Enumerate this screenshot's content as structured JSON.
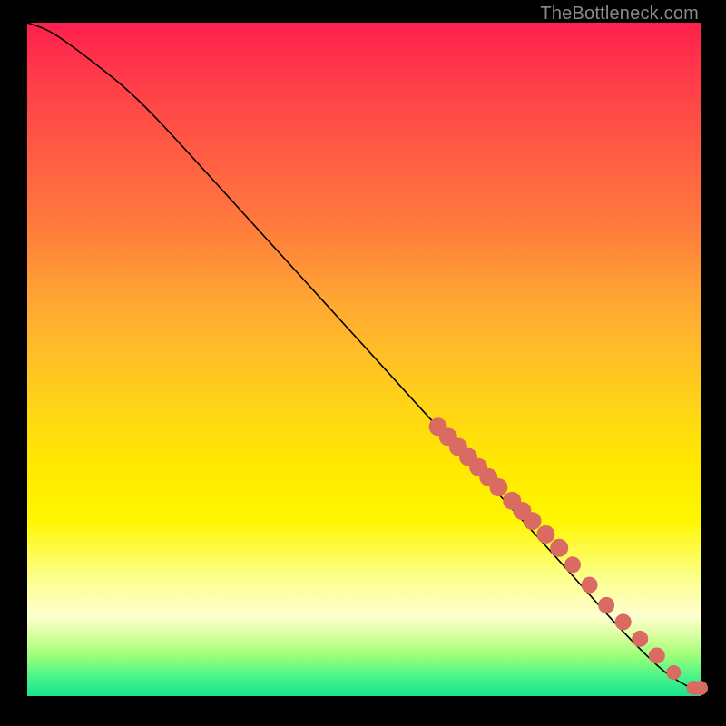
{
  "attribution": "TheBottleneck.com",
  "colors": {
    "dot": "#d96b62",
    "curve": "#000000"
  },
  "chart_data": {
    "type": "line",
    "title": "",
    "xlabel": "",
    "ylabel": "",
    "xlim": [
      0,
      100
    ],
    "ylim": [
      0,
      100
    ],
    "curve": {
      "x": [
        0,
        3,
        6,
        10,
        15,
        20,
        30,
        40,
        50,
        60,
        70,
        80,
        88,
        94,
        97,
        99,
        100
      ],
      "y": [
        100,
        99,
        97,
        94,
        90,
        85,
        74,
        63,
        52,
        41,
        30,
        19,
        10,
        4,
        2,
        1,
        1
      ]
    },
    "series": [
      {
        "name": "highlighted-points",
        "marker": "circle",
        "x": [
          61,
          62.5,
          64,
          65.5,
          67,
          68.5,
          70,
          72,
          73.5,
          75,
          77,
          79,
          81,
          83.5,
          86,
          88.5,
          91,
          93.5,
          96,
          99,
          100
        ],
        "y": [
          40,
          38.5,
          37,
          35.5,
          34,
          32.5,
          31,
          29,
          27.5,
          26,
          24,
          22,
          19.5,
          16.5,
          13.5,
          11,
          8.5,
          6,
          3.5,
          1.2,
          1.2
        ]
      }
    ]
  }
}
